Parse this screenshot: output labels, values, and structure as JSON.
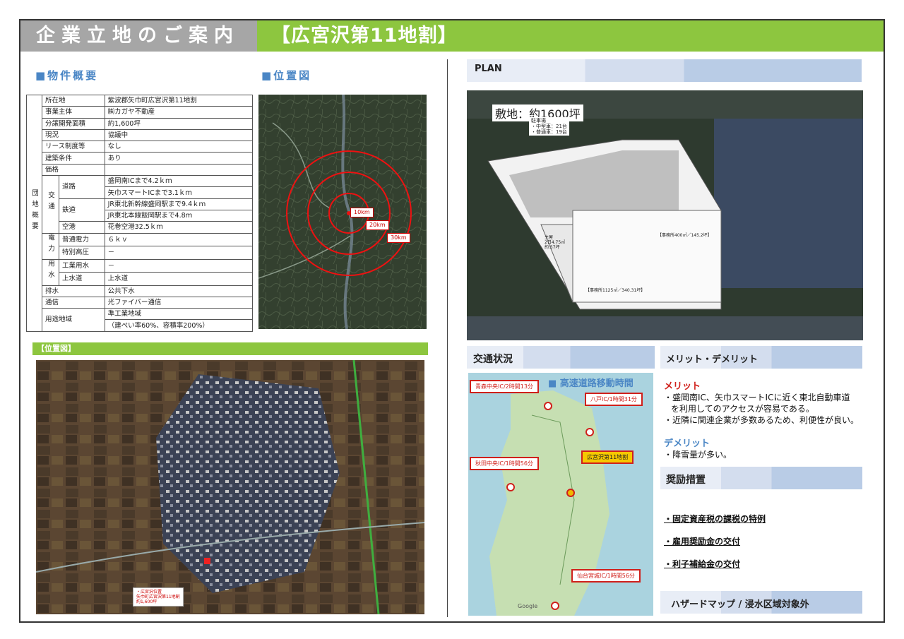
{
  "header": {
    "left": "企業立地のご案内",
    "right": "【広宮沢第11地割】"
  },
  "sections": {
    "property": "■物件概要",
    "location": "■位置図",
    "plan": "PLAN",
    "traffic": "交通状況",
    "merit": "メリット・デメリット",
    "incentive": "奨励措置",
    "hazard": "ハザードマップ / 浸水区域対象外"
  },
  "group_label": "団地概要",
  "table": {
    "rows": [
      {
        "label": "所在地",
        "value": "紫波郡矢巾町広宮沢第11地割"
      },
      {
        "label": "事業主体",
        "value": "㈱カガヤ不動産"
      },
      {
        "label": "分譲開発面積",
        "value": "約1,600坪"
      },
      {
        "label": "現況",
        "value": "協議中"
      },
      {
        "label": "リース制度等",
        "value": "なし"
      },
      {
        "label": "建築条件",
        "value": "あり"
      },
      {
        "label": "価格",
        "value": ""
      }
    ],
    "kotsu": {
      "group": "交通",
      "road": "道路",
      "road_v1": "盛岡南ICまで4.2ｋｍ",
      "road_v2": "矢巾スマートICまで3.1ｋｍ",
      "rail": "鉄道",
      "rail_v1": "JR東北新幹線盛岡駅まで9.4ｋｍ",
      "rail_v2": "JR東北本線飯岡駅まで4.8ｍ",
      "air": "空港",
      "air_v": "花巻空港32.5ｋｍ"
    },
    "denryoku": {
      "group": "電力",
      "normal": "普通電力",
      "normal_v": "６ｋｖ",
      "special": "特別高圧",
      "special_v": "－"
    },
    "yosui": {
      "group": "用水",
      "ind": "工業用水",
      "ind_v": "－",
      "city": "上水道",
      "city_v": "上水道"
    },
    "haisui": {
      "label": "排水",
      "value": "公共下水"
    },
    "tsushin": {
      "label": "通信",
      "value": "光ファイバー通信"
    },
    "yoto": {
      "label": "用途地域",
      "v1": "準工業地域",
      "v2": "（建ぺい率60%、容積率200%）"
    }
  },
  "radius_map": {
    "r1": "10km",
    "r2": "20km",
    "r3": "30km"
  },
  "bigmap": {
    "title": "【位置図】",
    "marker_l1": "・広宮沢位置",
    "marker_l2": "矢巾町広宮沢第11地割",
    "marker_l3": "約1,600坪"
  },
  "plan": {
    "area": "敷地：約1600坪",
    "parking": "駐車場",
    "parking2": "・中型車：21台",
    "parking3": "・普通車：19台",
    "office1": "【事務所400㎡／145.2坪】",
    "office2": "【事務所1125㎡／340.31坪】",
    "area2": "主屋",
    "area3": "2日4.75㎡",
    "area4": "約.57坪"
  },
  "traffic": {
    "title": "■ 高速道路移動時間",
    "aomori": "青森中央IC/2時間13分",
    "hachinohe": "八戸IC/1時間31分",
    "akita": "秋田中央IC/1時間56分",
    "hiromiya": "広宮沢第11地割",
    "sendai": "仙台宮城IC/1時間56分",
    "google": "Google"
  },
  "merit": {
    "h": "メリット",
    "l1": "・盛岡南IC、矢巾スマートICに近く東北自動車道",
    "l2": "を利用してのアクセスが容易である。",
    "l3": "・近隣に関連企業が多数あるため、利便性が良い。",
    "dh": "デメリット",
    "d1": "・降雪量が多い。"
  },
  "incentive": {
    "i1": "・固定資産税の課税の特例",
    "i2": "・雇用奨励金の交付",
    "i3": "・利子補給金の交付"
  },
  "colors": {
    "green": "#8dc63f",
    "gray": "#a6a6a6",
    "blue": "#4a86c5",
    "red": "#d0201b"
  }
}
